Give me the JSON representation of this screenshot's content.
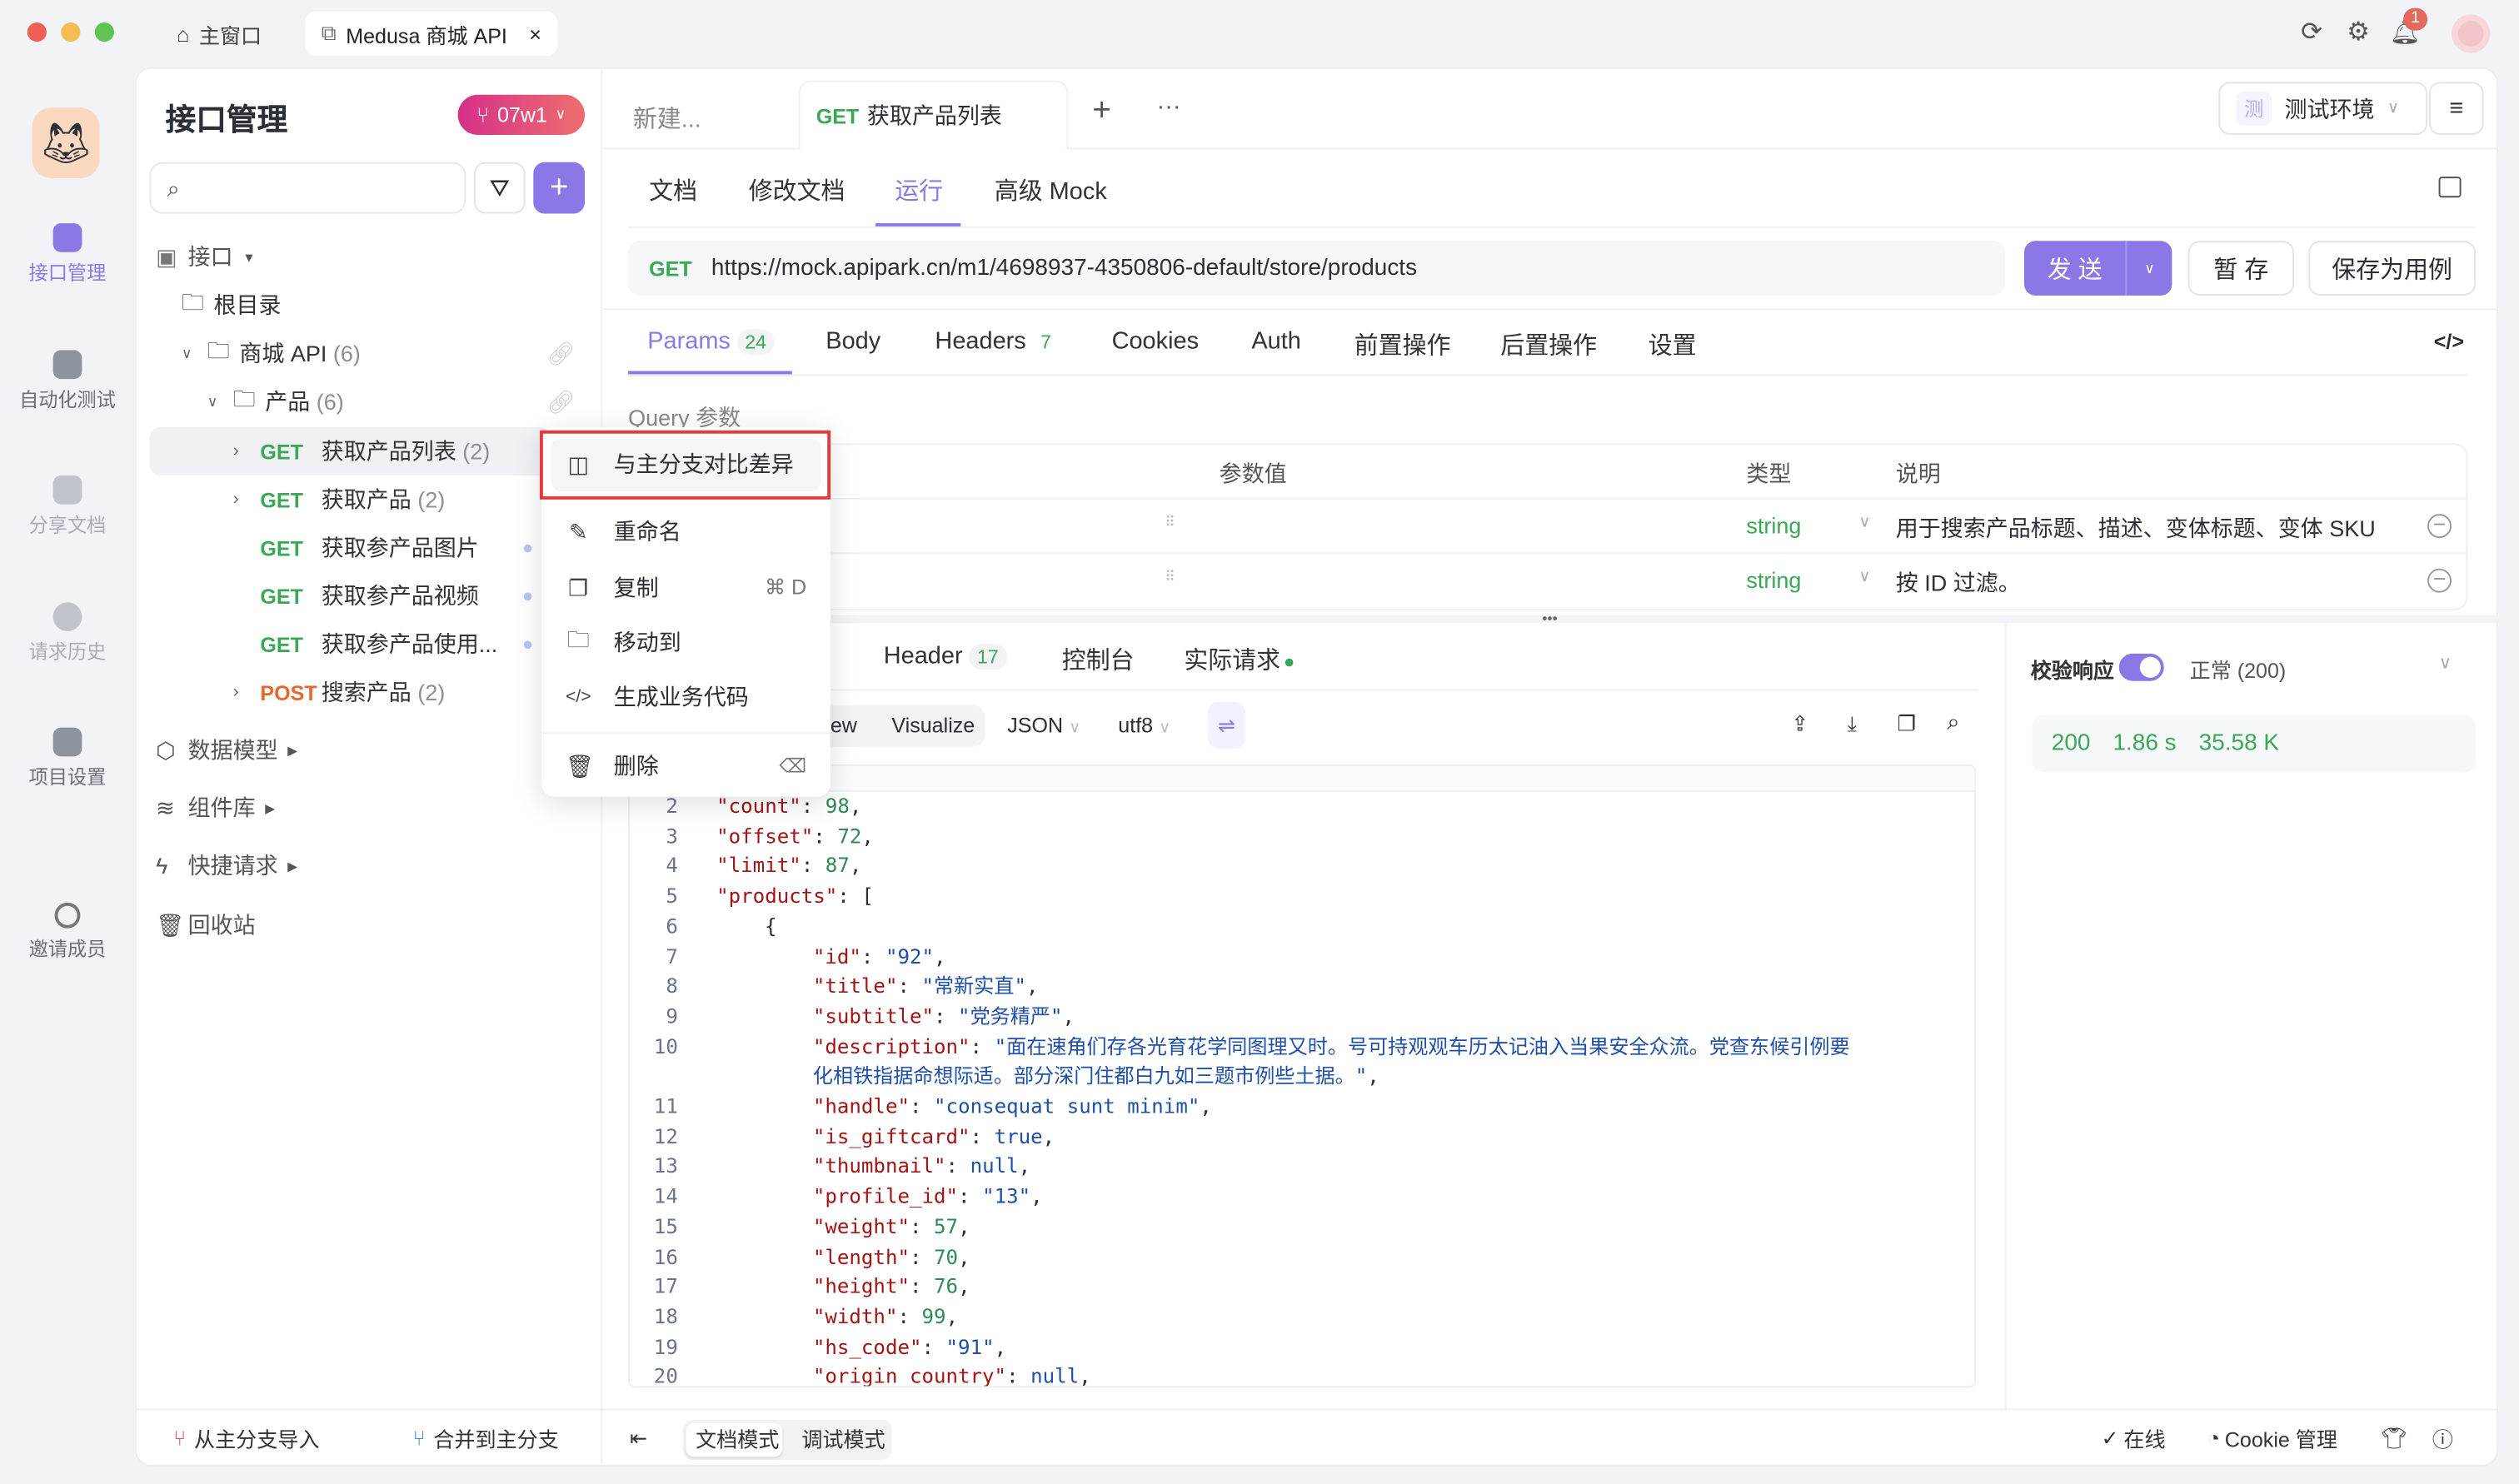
{
  "window": {
    "tabs": [
      {
        "label": "主窗口",
        "icon": "home-icon"
      },
      {
        "label": "Medusa 商城 API",
        "icon": "external-window-icon",
        "close": "×"
      }
    ],
    "notification_count": "1"
  },
  "rail": {
    "items": [
      {
        "label": "接口管理",
        "active": true
      },
      {
        "label": "自动化测试"
      },
      {
        "label": "分享文档"
      },
      {
        "label": "请求历史"
      },
      {
        "label": "项目设置"
      },
      {
        "label": "邀请成员"
      }
    ]
  },
  "sidebar": {
    "title": "接口管理",
    "branch": "07w1",
    "search_placeholder": "",
    "tree": {
      "section": "接口",
      "root": "根目录",
      "folder1": "商城 API",
      "folder1_count": "(6)",
      "folder2": "产品",
      "folder2_count": "(6)",
      "items": [
        {
          "method": "GET",
          "name": "获取产品列表",
          "count": "(2)"
        },
        {
          "method": "GET",
          "name": "获取产品",
          "count": "(2)"
        },
        {
          "method": "GET",
          "name": "获取参产品图片"
        },
        {
          "method": "GET",
          "name": "获取参产品视频"
        },
        {
          "method": "GET",
          "name": "获取参产品使用..."
        },
        {
          "method": "POST",
          "name": "搜索产品",
          "count": "(2)"
        }
      ]
    },
    "sections": [
      "数据模型",
      "组件库",
      "快捷请求",
      "回收站"
    ],
    "footer": {
      "import": "从主分支导入",
      "merge": "合并到主分支"
    }
  },
  "context_menu": {
    "items": [
      {
        "label": "与主分支对比差异",
        "highlighted": true
      },
      {
        "label": "重命名"
      },
      {
        "label": "复制",
        "shortcut": "⌘ D"
      },
      {
        "label": "移动到"
      },
      {
        "label": "生成业务代码"
      },
      {
        "label": "删除"
      }
    ]
  },
  "editor": {
    "tabs": [
      {
        "label": "新建..."
      },
      {
        "method": "GET",
        "label": "获取产品列表",
        "active": true
      }
    ],
    "more": "···",
    "env_badge": "测",
    "env": "测试环境",
    "subtabs": [
      "文档",
      "修改文档",
      "运行",
      "高级 Mock"
    ],
    "active_subtab": "运行",
    "request": {
      "method": "GET",
      "url": "https://mock.apipark.cn/m1/4698937-4350806-default/store/products",
      "send": "发 送",
      "save_draft": "暂 存",
      "save_case": "保存为用例"
    },
    "param_tabs": [
      {
        "label": "Params",
        "count": "24",
        "active": true
      },
      {
        "label": "Body"
      },
      {
        "label": "Headers",
        "count": "7"
      },
      {
        "label": "Cookies"
      },
      {
        "label": "Auth"
      },
      {
        "label": "前置操作"
      },
      {
        "label": "后置操作"
      },
      {
        "label": "设置"
      }
    ],
    "query_title": "Query 参数",
    "table": {
      "headers": [
        "参数值",
        "类型",
        "说明"
      ],
      "rows": [
        {
          "type": "string",
          "desc": "用于搜索产品标题、描述、变体标题、变体 SKU"
        },
        {
          "type": "string",
          "desc": "按 ID 过滤。"
        }
      ]
    }
  },
  "response": {
    "tabs": [
      {
        "label": "Header",
        "count": "17"
      },
      {
        "label": "控制台"
      },
      {
        "label": "实际请求"
      }
    ],
    "toolbar": {
      "view": "iew",
      "visualize": "Visualize",
      "format": "JSON",
      "encoding": "utf8"
    },
    "validate_label": "校验响应",
    "validate_on": true,
    "status_select": "正常 (200)",
    "stats": {
      "status": "200",
      "time": "1.86 s",
      "size": "35.58 K"
    },
    "lines": [
      {
        "n": "2",
        "i": 1,
        "k": "\"count\"",
        "v": "98",
        "t": "n",
        "e": ","
      },
      {
        "n": "3",
        "i": 1,
        "k": "\"offset\"",
        "v": "72",
        "t": "n",
        "e": ","
      },
      {
        "n": "4",
        "i": 1,
        "k": "\"limit\"",
        "v": "87",
        "t": "n",
        "e": ","
      },
      {
        "n": "5",
        "i": 1,
        "k": "\"products\"",
        "v": "[",
        "t": "p",
        "e": ""
      },
      {
        "n": "6",
        "i": 2,
        "k": "",
        "v": "{",
        "t": "p",
        "e": ""
      },
      {
        "n": "7",
        "i": 3,
        "k": "\"id\"",
        "v": "\"92\"",
        "t": "s",
        "e": ","
      },
      {
        "n": "8",
        "i": 3,
        "k": "\"title\"",
        "v": "\"常新实直\"",
        "t": "s",
        "e": ","
      },
      {
        "n": "9",
        "i": 3,
        "k": "\"subtitle\"",
        "v": "\"党务精严\"",
        "t": "s",
        "e": ","
      },
      {
        "n": "10",
        "i": 3,
        "k": "\"description\"",
        "v": "\"面在速角们存各光育花学同图理又时。号可持观观车历太记油入当果安全众流。党查东候引例要化相铁指据命想际适。部分深门住都白九如三题市例些土据。\"",
        "t": "s",
        "e": ","
      },
      {
        "n": "11",
        "i": 3,
        "k": "\"handle\"",
        "v": "\"consequat sunt minim\"",
        "t": "s",
        "e": ","
      },
      {
        "n": "12",
        "i": 3,
        "k": "\"is_giftcard\"",
        "v": "true",
        "t": "l",
        "e": ","
      },
      {
        "n": "13",
        "i": 3,
        "k": "\"thumbnail\"",
        "v": "null",
        "t": "l",
        "e": ","
      },
      {
        "n": "14",
        "i": 3,
        "k": "\"profile_id\"",
        "v": "\"13\"",
        "t": "s",
        "e": ","
      },
      {
        "n": "15",
        "i": 3,
        "k": "\"weight\"",
        "v": "57",
        "t": "n",
        "e": ","
      },
      {
        "n": "16",
        "i": 3,
        "k": "\"length\"",
        "v": "70",
        "t": "n",
        "e": ","
      },
      {
        "n": "17",
        "i": 3,
        "k": "\"height\"",
        "v": "76",
        "t": "n",
        "e": ","
      },
      {
        "n": "18",
        "i": 3,
        "k": "\"width\"",
        "v": "99",
        "t": "n",
        "e": ","
      },
      {
        "n": "19",
        "i": 3,
        "k": "\"hs_code\"",
        "v": "\"91\"",
        "t": "s",
        "e": ","
      },
      {
        "n": "20",
        "i": 3,
        "k": "\"origin_country\"",
        "v": "null",
        "t": "l",
        "e": ","
      }
    ]
  },
  "footer": {
    "doc_mode": "文档模式",
    "debug_mode": "调试模式",
    "online": "在线",
    "cookie": "Cookie 管理"
  },
  "colors": {
    "accent": "#8b78e6",
    "get": "#3aa757",
    "post": "#e8672c",
    "highlight_border": "#e5393f",
    "branch_gradient": [
      "#d6308a",
      "#ee6e6e"
    ]
  }
}
